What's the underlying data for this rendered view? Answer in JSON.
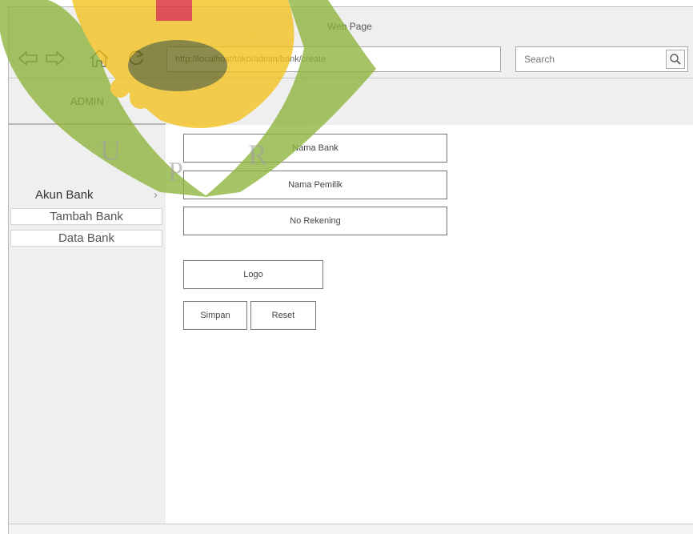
{
  "window": {
    "title": "Web Page"
  },
  "nav": {
    "back_icon": "arrow-left-icon",
    "forward_icon": "arrow-right-icon",
    "home_icon": "home-icon",
    "reload_icon": "reload-icon",
    "url": "http://localhost/toko/admin/bank/create"
  },
  "search": {
    "placeholder": "Search",
    "icon": "search-icon"
  },
  "sidebar": {
    "title": "ADMIN",
    "group": {
      "label": "Akun Bank",
      "chevron": "›"
    },
    "items": [
      {
        "label": "Tambah Bank"
      },
      {
        "label": "Data Bank"
      }
    ]
  },
  "form": {
    "nama_bank": "Nama Bank",
    "nama_pemilik": "Nama Pemilik",
    "no_rekening": "No Rekening",
    "logo": "Logo",
    "save_label": "Simpan",
    "reset_label": "Reset"
  },
  "watermark": {
    "letters": [
      "U",
      "P",
      "R"
    ],
    "colors": {
      "green": "#8db43a",
      "yellow": "#f2c21b",
      "red": "#d8262d",
      "olive": "#6c6a1a"
    }
  }
}
